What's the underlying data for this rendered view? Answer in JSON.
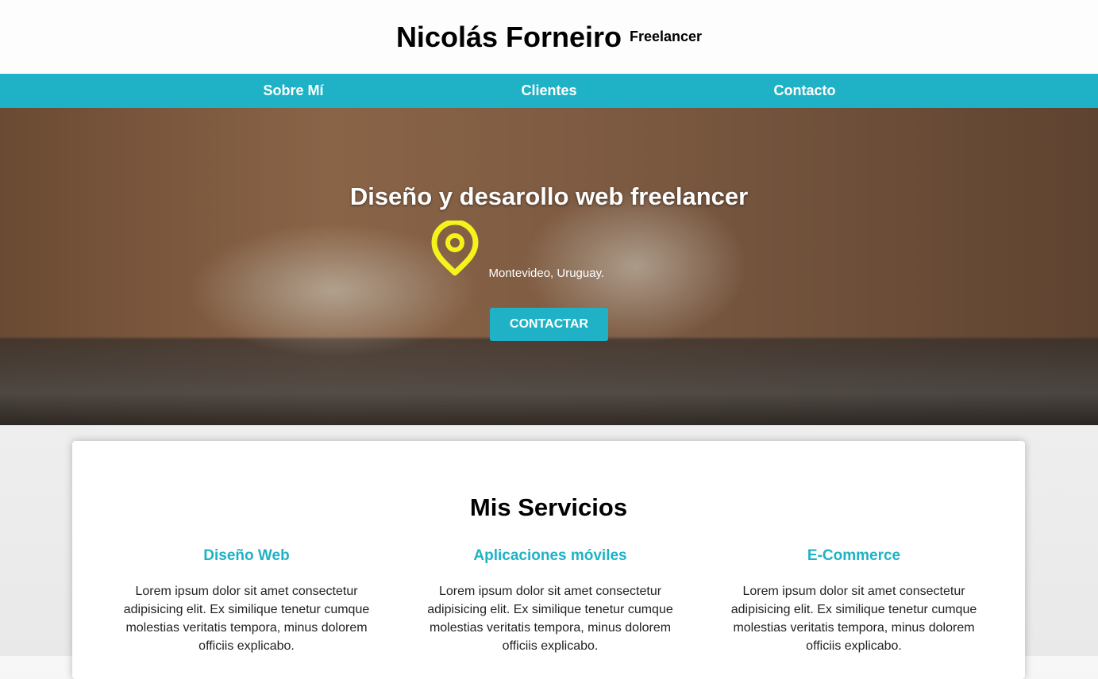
{
  "header": {
    "title": "Nicolás Forneiro",
    "subtitle": "Freelancer"
  },
  "nav": [
    {
      "label": "Sobre Mí"
    },
    {
      "label": "Clientes"
    },
    {
      "label": "Contacto"
    }
  ],
  "hero": {
    "heading": "Diseño y desarollo web freelancer",
    "location": "Montevideo, Uruguay.",
    "cta": "CONTACTAR"
  },
  "services": {
    "title": "Mis Servicios",
    "items": [
      {
        "title": "Diseño Web",
        "text": "Lorem ipsum dolor sit amet consectetur adipisicing elit. Ex similique tenetur cumque molestias veritatis tempora, minus dolorem officiis explicabo."
      },
      {
        "title": "Aplicaciones móviles",
        "text": "Lorem ipsum dolor sit amet consectetur adipisicing elit. Ex similique tenetur cumque molestias veritatis tempora, minus dolorem officiis explicabo."
      },
      {
        "title": "E-Commerce",
        "text": "Lorem ipsum dolor sit amet consectetur adipisicing elit. Ex similique tenetur cumque molestias veritatis tempora, minus dolorem officiis explicabo."
      }
    ]
  },
  "colors": {
    "accent": "#1fb2c6",
    "pin": "#f5f31c"
  }
}
